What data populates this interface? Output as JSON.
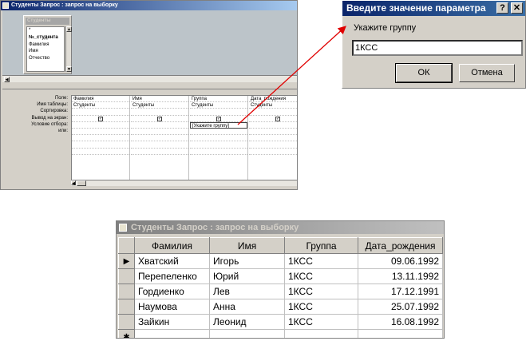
{
  "query_window": {
    "title": "Студенты Запрос : запрос на выборку",
    "field_list": {
      "title": "Студенты",
      "items": [
        "*",
        "№_студента",
        "Фамилия",
        "Имя",
        "Отчество"
      ]
    },
    "row_labels": [
      "Поле:",
      "Имя таблицы:",
      "Сортировка:",
      "Вывод на экран:",
      "Условие отбора:",
      "или:"
    ],
    "columns": [
      {
        "field": "Фамилия",
        "table": "Студенты",
        "criteria": ""
      },
      {
        "field": "Имя",
        "table": "Студенты",
        "criteria": ""
      },
      {
        "field": "Группа",
        "table": "Студенты",
        "criteria": "[Укажите группу]"
      },
      {
        "field": "Дата_рождения",
        "table": "Студенты",
        "criteria": ""
      }
    ],
    "checkmark": "✓"
  },
  "dialog": {
    "title": "Введите значение параметра",
    "help_label": "?",
    "close_label": "✕",
    "prompt": "Укажите группу",
    "value": "1КСС",
    "ok_label": "ОК",
    "cancel_label": "Отмена"
  },
  "result_window": {
    "title": "Студенты Запрос : запрос на выборку",
    "headers": [
      "Фамилия",
      "Имя",
      "Группа",
      "Дата_рождения"
    ],
    "rows": [
      [
        "Хватский",
        "Игорь",
        "1КСС",
        "09.06.1992"
      ],
      [
        "Перепеленко",
        "Юрий",
        "1КСС",
        "13.11.1992"
      ],
      [
        "Гордиенко",
        "Лев",
        "1КСС",
        "17.12.1991"
      ],
      [
        "Наумова",
        "Анна",
        "1КСС",
        "25.07.1992"
      ],
      [
        "Зайкин",
        "Леонид",
        "1КСС",
        "16.08.1992"
      ]
    ],
    "current_row_marker": "▶",
    "new_row_marker": "✱"
  },
  "colors": {
    "arrow": "#e00000",
    "title_active": "#0a246a",
    "title_inactive": "#808080"
  }
}
